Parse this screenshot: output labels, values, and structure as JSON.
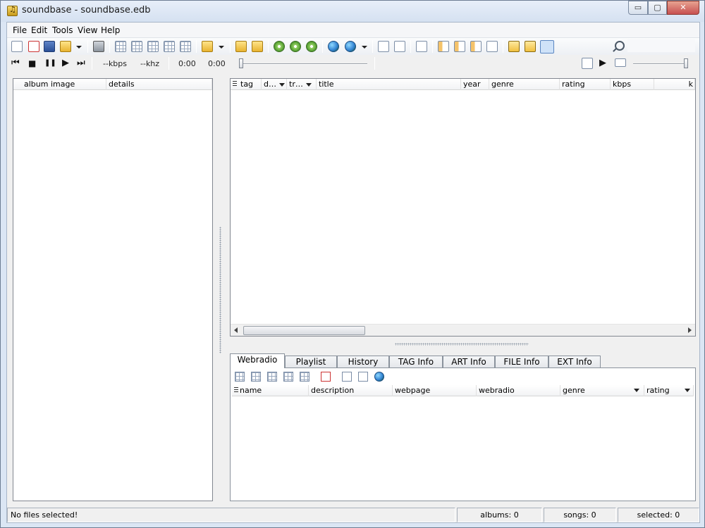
{
  "window": {
    "title": "soundbase - soundbase.edb",
    "min_label": "▭",
    "max_label": "▢",
    "close_label": "✕"
  },
  "menu": [
    "File",
    "Edit",
    "Tools",
    "View",
    "Help"
  ],
  "player": {
    "bitrate": "--kbps",
    "samplerate": "--khz",
    "elapsed": "0:00",
    "total": "0:00",
    "prev_glyph": "⏮",
    "stop_glyph": "■",
    "pause_glyph": "❚❚",
    "play_glyph": "▶",
    "next_glyph": "⏭"
  },
  "search": {
    "placeholder": ""
  },
  "left_pane": {
    "columns": [
      "album image",
      "details"
    ]
  },
  "songs": {
    "columns": [
      "tag",
      "d…",
      "tr…",
      "title",
      "year",
      "genre",
      "rating",
      "kbps",
      "k"
    ]
  },
  "tabs": [
    "Webradio",
    "Playlist",
    "History",
    "TAG Info",
    "ART Info",
    "FILE Info",
    "EXT Info"
  ],
  "active_tab": "Webradio",
  "webradio": {
    "columns": [
      "name",
      "description",
      "webpage",
      "webradio",
      "genre",
      "rating"
    ]
  },
  "status": {
    "message": "No files selected!",
    "albums": "albums: 0",
    "songs": "songs: 0",
    "selected": "selected: 0"
  }
}
